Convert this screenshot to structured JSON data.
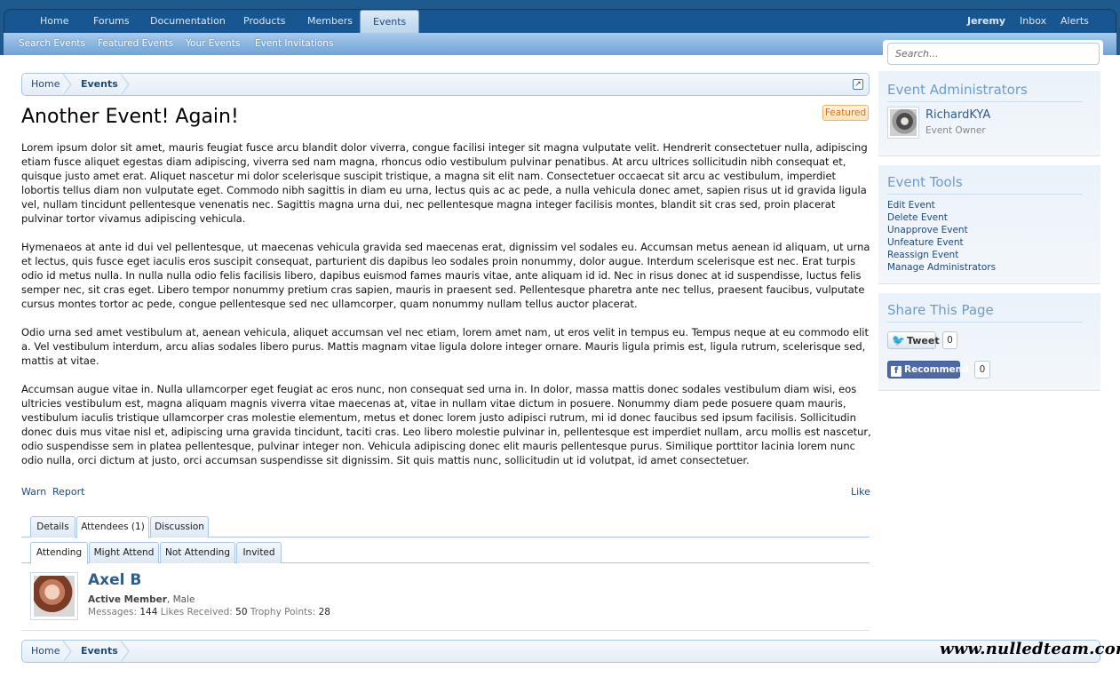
{
  "nav": {
    "tabs": [
      "Home",
      "Forums",
      "Documentation",
      "Products",
      "Members",
      "Events"
    ],
    "active_tab": "Events",
    "user": {
      "name": "Jeremy",
      "inbox": "Inbox",
      "alerts": "Alerts"
    },
    "sub_tabs": [
      "Search Events",
      "Featured Events",
      "Your Events",
      "Event Invitations"
    ]
  },
  "breadcrumb": {
    "items": [
      "Home",
      "Events"
    ]
  },
  "event": {
    "title": "Another Event! Again!",
    "badge": "Featured",
    "paragraphs": [
      "Lorem ipsum dolor sit amet, mauris feugiat fusce arcu blandit dolor viverra, congue facilisi integer sit magna vulputate velit. Hendrerit consectetuer nulla, adipiscing etiam fusce aliquet egestas diam adipiscing, viverra sed nam magna, rhoncus odio vestibulum pulvinar penatibus. At arcu ultrices sollicitudin nibh consequat et, quisque justo amet erat. Aliquet nascetur mi dolor scelerisque suscipit tristique, a magna sit elit nam. Consectetuer occaecat sit arcu ac vestibulum, imperdiet lobortis tellus diam non vulputate eget. Commodo nibh sagittis in diam eu urna, lectus quis ac ac pede, a nulla vehicula donec amet, sapien risus ut id gravida ligula vel, nullam tincidunt pellentesque venenatis nec. Sagittis magna urna dui, nec pellentesque magna integer facilisis montes, blandit sit cras sed, proin placerat pulvinar tortor vivamus adipiscing vehicula.",
      "Hymenaeos at ante id dui vel pellentesque, ut maecenas vehicula gravida sed maecenas erat, dignissim vel sodales eu. Accumsan metus aenean id aliquam, ut urna et lectus, quis fusce eget iaculis eros suscipit consequat, parturient dis dapibus leo sodales proin nonummy, dolor augue. Interdum scelerisque est nec. Erat turpis odio id metus nulla. In nulla nulla odio felis facilisis libero, dapibus euismod fames mauris vitae, ante aliquam id id. Nec in risus donec at id suspendisse, luctus felis semper nec, sit cras eget. Libero tempor nonummy pretium cras sapien, mauris in praesent sed. Pellentesque pharetra ante nec tellus, praesent faucibus, vulputate cursus montes tortor ac pede, congue pellentesque sed nec ullamcorper, quam nonummy nullam tellus auctor placerat.",
      "Odio urna sed amet vestibulum at, aenean vehicula, aliquet accumsan vel nec etiam, lorem amet nam, ut eros velit in tempus eu. Tempus neque at eu commodo elit a. Vel vestibulum interdum, arcu alias sodales libero purus. Mattis magnam vitae ligula dolore integer ornare. Mauris ligula primis est, ligula rutrum, scelerisque sed, mattis at vitae.",
      "Accumsan augue vitae in. Nulla ullamcorper eget feugiat ac eros nunc, non consequat sed urna in. In dolor, massa mattis donec sodales vestibulum diam wisi, eos ultricies vestibulum est, magna aliquam magnis viverra vitae maecenas at, vitae in nullam vitae dictum in posuere. Nonummy diam pede posuere quam mauris, vestibulum iaculis tristique ullamcorper cras molestie elementum, metus et donec lorem justo adipisci rutrum, mi id donec faucibus sed ipsum facilisis. Sollicitudin donec duis mus vitae nisl et, adipiscing urna gravida tincidunt, taciti cras. Leo libero molestie pulvinar in, pellentesque est imperdiet nullam, arcu mollis est nascetur, odio suspendisse sem in platea pellentesque, pulvinar integer non. Vehicula adipiscing donec elit mauris pellentesque purus. Similique porttitor lacinia lorem nunc odio nulla, orci dictum at justo, orci accumsan suspendisse sit dignissim. Sit quis mattis nunc, sollicitudin ut id volutpat, id amet consectetuer."
    ],
    "actions": {
      "warn": "Warn",
      "report": "Report",
      "like": "Like"
    }
  },
  "tabs": {
    "main": [
      "Details",
      "Attendees (1)",
      "Discussion"
    ],
    "main_active": "Attendees (1)",
    "sub": [
      "Attending",
      "Might Attend",
      "Not Attending",
      "Invited"
    ],
    "sub_active": "Attending"
  },
  "attendee": {
    "name": "Axel B",
    "title": "Active Member",
    "gender": ", Male",
    "messages_label": "Messages:",
    "messages": "144",
    "likes_label": "Likes Received:",
    "likes": "50",
    "trophy_label": "Trophy Points:",
    "trophy": "28"
  },
  "sidebar": {
    "search_placeholder": "Search...",
    "administrators": {
      "heading": "Event Administrators",
      "name": "RichardKYA",
      "role": "Event Owner"
    },
    "tools": {
      "heading": "Event Tools",
      "links": [
        "Edit Event",
        "Delete Event",
        "Unapprove Event",
        "Unfeature Event",
        "Reassign Event",
        "Manage Administrators"
      ]
    },
    "share": {
      "heading": "Share This Page",
      "tweet_label": "Tweet",
      "tweet_count": "0",
      "recommend_label": "Recommend",
      "recommend_count": "0"
    }
  },
  "watermark": "www.nulledteam.com",
  "colors": {
    "header_bg": "#1e5a8e",
    "link": "#1d4a77",
    "heading": "#6d9ccc",
    "featured": "#d3711a"
  }
}
